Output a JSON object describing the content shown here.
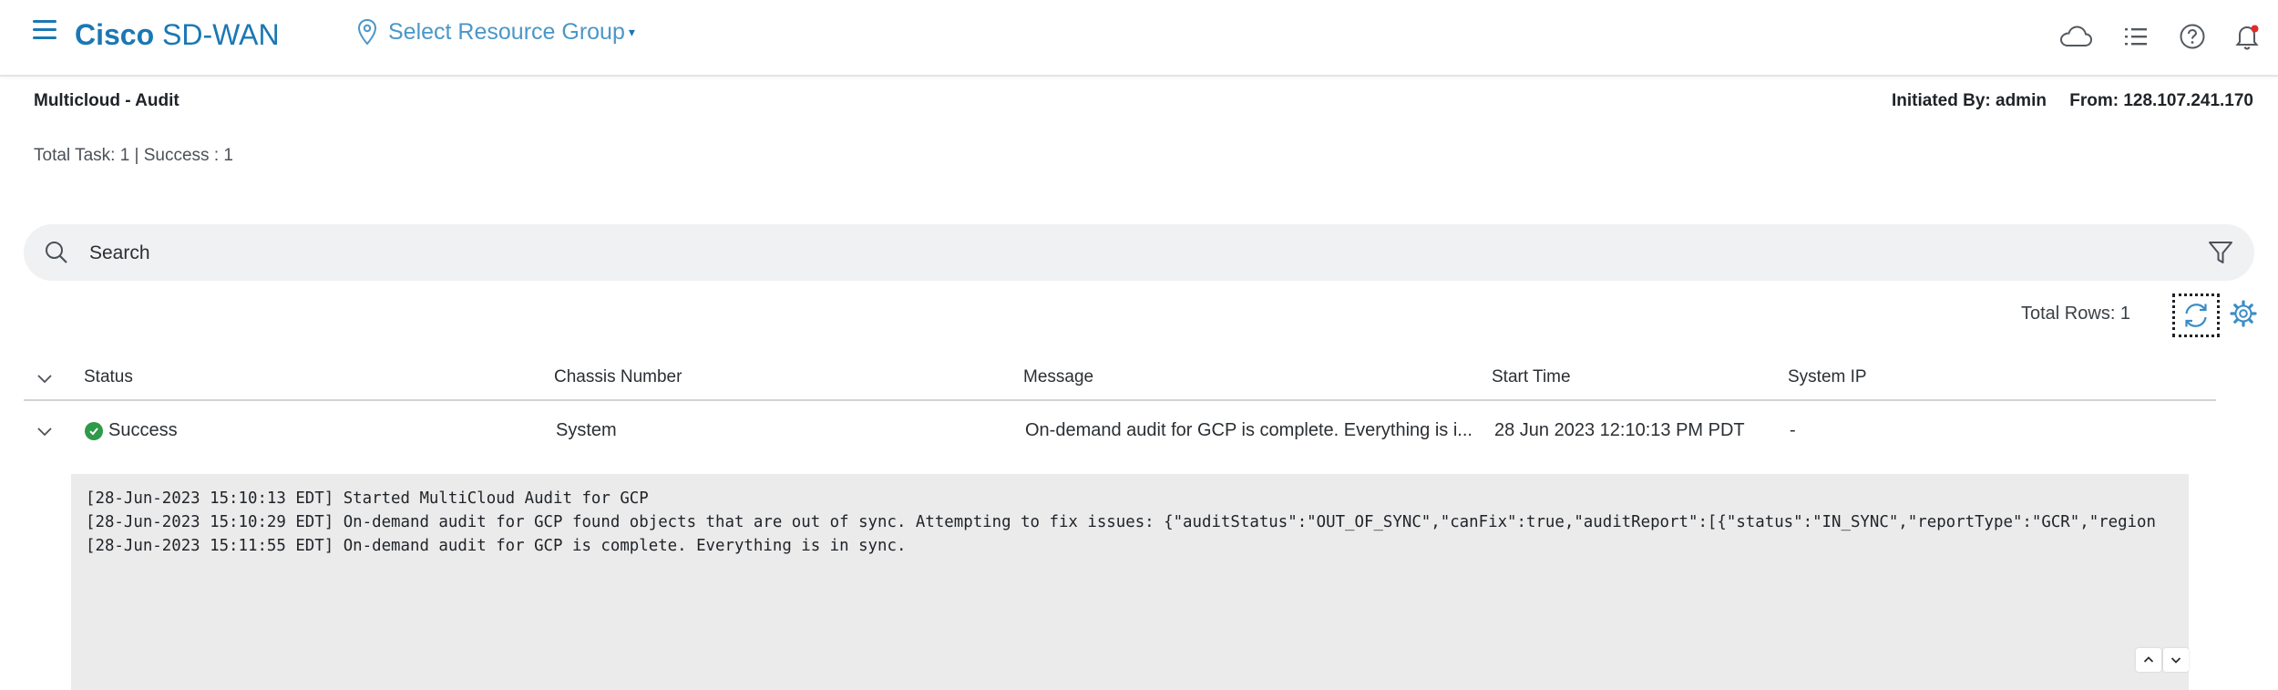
{
  "header": {
    "brand_bold": "Cisco",
    "brand_light": "SD-WAN",
    "resource_group": "Select Resource Group",
    "resource_caret": "▾"
  },
  "page": {
    "title": "Multicloud - Audit",
    "initiated_by": "Initiated By: admin",
    "from": "From: 128.107.241.170",
    "totals": "Total Task: 1 | Success : 1"
  },
  "search": {
    "placeholder": "Search"
  },
  "table": {
    "total_rows": "Total Rows: 1",
    "columns": [
      "Status",
      "Chassis Number",
      "Message",
      "Start Time",
      "System IP"
    ],
    "rows": [
      {
        "status": "Success",
        "chassis": "System",
        "message": "On-demand audit for GCP is complete. Everything is i...",
        "start_time": "28 Jun 2023 12:10:13 PM PDT",
        "system_ip": "-"
      }
    ]
  },
  "log": {
    "lines": [
      "[28-Jun-2023 15:10:13 EDT] Started MultiCloud Audit for GCP",
      "[28-Jun-2023 15:10:29 EDT] On-demand audit for GCP found objects that are out of sync. Attempting to fix issues: {\"auditStatus\":\"OUT_OF_SYNC\",\"canFix\":true,\"auditReport\":[{\"status\":\"IN_SYNC\",\"reportType\":\"GCR\",\"region",
      "[28-Jun-2023 15:11:55 EDT] On-demand audit for GCP is complete. Everything is in sync."
    ]
  },
  "icons": {
    "menu": "menu-icon",
    "location": "location-pin-icon",
    "cloud": "cloud-icon",
    "list": "list-icon",
    "help": "help-icon",
    "bell": "bell-icon",
    "search": "search-icon",
    "filter": "filter-icon",
    "refresh": "refresh-icon",
    "settings": "gear-icon"
  },
  "colors": {
    "brand": "#1a78b4",
    "success": "#2e9a4a",
    "notification_dot": "#e02b2b"
  }
}
